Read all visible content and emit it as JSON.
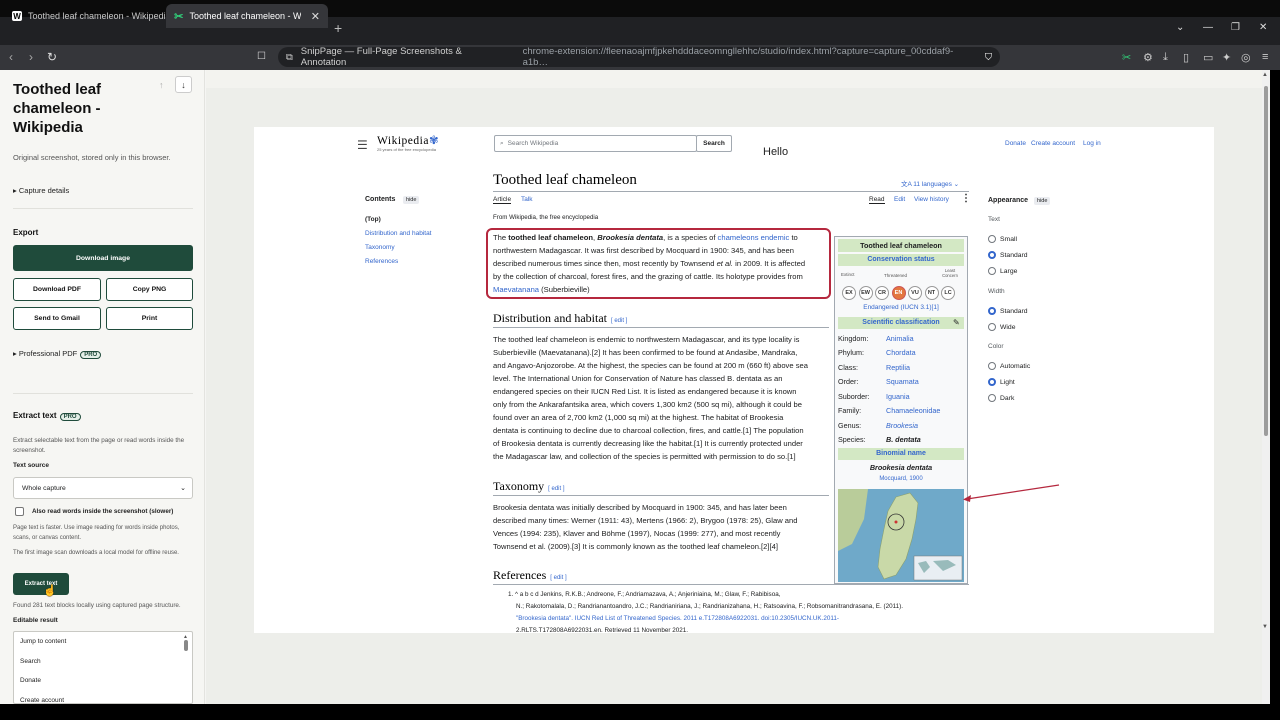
{
  "browser": {
    "tabs": [
      {
        "title": "Toothed leaf chameleon - Wikipedia",
        "favicon": "W"
      },
      {
        "title": "Toothed leaf chameleon - Wikip…",
        "favicon": "✂"
      }
    ],
    "site_name": "SnipPage — Full-Page Screenshots & Annotation",
    "url": "chrome-extension://fleenaoajmfjpkehdddaceomngllehhc/studio/index.html?capture=capture_00cddaf9-a1b…"
  },
  "sidebar": {
    "title": "Toothed leaf chameleon - Wikipedia",
    "subtitle": "Original screenshot, stored only in this browser.",
    "capture_details": "Capture details",
    "export_heading": "Export",
    "download_image": "Download image",
    "download_pdf": "Download PDF",
    "copy_png": "Copy PNG",
    "send_gmail": "Send to Gmail",
    "print": "Print",
    "professional_pdf": "Professional PDF",
    "pro_badge": "PRO",
    "extract_heading": "Extract text",
    "extract_desc": "Extract selectable text from the page or read words inside the screenshot.",
    "text_source_label": "Text source",
    "text_source_value": "Whole capture",
    "also_read_label": "Also read words inside the screenshot (slower)",
    "hint1": "Page text is faster. Use image reading for words inside photos, scans, or canvas content.",
    "hint2": "The first image scan downloads a local model for offline reuse.",
    "extract_button": "Extract text",
    "found_text": "Found 281 text blocks locally using captured page structure.",
    "editable_label": "Editable result",
    "result_items": [
      "Jump to content",
      "Search",
      "Donate",
      "Create account"
    ]
  },
  "wiki": {
    "logo": "Wikipedia",
    "logo_sub": "25 years of the free encyclopedia",
    "search_placeholder": "Search Wikipedia",
    "search_button": "Search",
    "hello": "Hello",
    "donate": "Donate",
    "create_account": "Create account",
    "login": "Log in",
    "title": "Toothed leaf chameleon",
    "languages": "11 languages",
    "tab_article": "Article",
    "tab_talk": "Talk",
    "tab_read": "Read",
    "tab_edit": "Edit",
    "tab_history": "View history",
    "from": "From Wikipedia, the free encyclopedia",
    "toc": {
      "title": "Contents",
      "hide": "hide",
      "items": [
        "(Top)",
        "Distribution and habitat",
        "Taxonomy",
        "References"
      ]
    },
    "intro": {
      "p1": "The ",
      "bold1": "toothed leaf chameleon",
      "p2": ", ",
      "bold2": "Brookesia dentata",
      "p3": ", is a species of ",
      "link1": "chameleons",
      "link2": "endemic",
      "p4": " to",
      "line2": "northwestern Madagascar. It was first described by Mocquard in 1900: 345, and has been",
      "line3a": "described numerous times since then, most recently by Townsend ",
      "line3b": "et al.",
      "line3c": " in 2009. It is affected",
      "line4": "by the collection of charcoal, forest fires, and the grazing of cattle. Its holotype provides from",
      "link3": "Maevatanana",
      "p5": " (Suberbieville)"
    },
    "dist": {
      "heading": "Distribution and habitat",
      "edit": "[ edit ]",
      "lines": [
        "The toothed leaf chameleon is endemic to northwestern Madagascar, and its type locality is",
        "Suberbieville (Maevatanana).[2] It has been confirmed to be found at Andasibe, Mandraka,",
        "and Angavo-Anjozorobe. At the highest, the species can be found at 200 m (660 ft) above sea",
        "level. The International Union for Conservation of Nature has classed B. dentata as an",
        "endangered species on their IUCN Red List. It is listed as endangered because it is known",
        "only from the Ankarafantsika area, which covers 1,300 km2 (500 sq mi), although it could be",
        "found over an area of 2,700 km2 (1,000 sq mi) at the highest. The habitat of Brookesia",
        "dentata is continuing to decline due to charcoal collection, fires, and cattle.[1] The population",
        "of Brookesia dentata is currently decreasing like the habitat.[1] It is currently protected under",
        "the Madagascar law, and collection of the species is permitted with permission to do so.[1]"
      ]
    },
    "tax": {
      "heading": "Taxonomy",
      "edit": "[ edit ]",
      "lines": [
        "Brookesia dentata was initially described by Mocquard in 1900: 345, and has later been",
        "described many times: Werner (1911: 43), Mertens (1966: 2), Brygoo (1978: 25), Glaw and",
        "Vences (1994: 235), Klaver and Böhme (1997), Nocas (1999: 277), and most recently",
        "Townsend et al. (2009).[3] It is commonly known as the toothed leaf chameleon.[2][4]"
      ]
    },
    "refs": {
      "heading": "References",
      "edit": "[ edit ]",
      "line1": "1. ^ a b c d Jenkins, R.K.B.; Andreone, F.; Andriamazava, A.; Anjeriniaina, M.; Glaw, F.; Rabibisoa,",
      "line2": "N.; Rakotomalala, D.; Randrianantoandro, J.C.; Randrianiriana, J.; Randrianizahana, H.; Ratsoavina, F.; Robsomanitrandrasana, E. (2011).",
      "line3": "\"Brookesia dentata\". IUCN Red List of Threatened Species. 2011 e.T172808A6922031. doi:10.2305/IUCN.UK.2011-",
      "line4": "2.RLTS.T172808A6922031.en. Retrieved 11 November 2021."
    },
    "infobox": {
      "title": "Toothed leaf chameleon",
      "cons_heading": "Conservation status",
      "extinct": "Extinct",
      "threatened": "Threatened",
      "least_concern": "Least Concern",
      "statuses": [
        "EX",
        "EW",
        "CR",
        "EN",
        "VU",
        "NT",
        "LC"
      ],
      "status_text": "Endangered (IUCN 3.1)[1]",
      "sci_heading": "Scientific classification",
      "rows": [
        {
          "k": "Kingdom:",
          "v": "Animalia"
        },
        {
          "k": "Phylum:",
          "v": "Chordata"
        },
        {
          "k": "Class:",
          "v": "Reptilia"
        },
        {
          "k": "Order:",
          "v": "Squamata"
        },
        {
          "k": "Suborder:",
          "v": "Iguania"
        },
        {
          "k": "Family:",
          "v": "Chamaeleonidae"
        },
        {
          "k": "Genus:",
          "v": "Brookesia"
        },
        {
          "k": "Species:",
          "v": "B. dentata"
        }
      ],
      "binomial_heading": "Binomial name",
      "binomial": "Brookesia dentata",
      "authority": "Mocquard, 1900"
    },
    "appearance": {
      "title": "Appearance",
      "hide": "hide",
      "text_label": "Text",
      "text_opts": [
        "Small",
        "Standard",
        "Large"
      ],
      "width_label": "Width",
      "width_opts": [
        "Standard",
        "Wide"
      ],
      "color_label": "Color",
      "color_opts": [
        "Automatic",
        "Light",
        "Dark"
      ]
    }
  },
  "colors": {
    "accent": "#1f4b3b",
    "link": "#3366cc",
    "annotation": "#b5283e"
  }
}
